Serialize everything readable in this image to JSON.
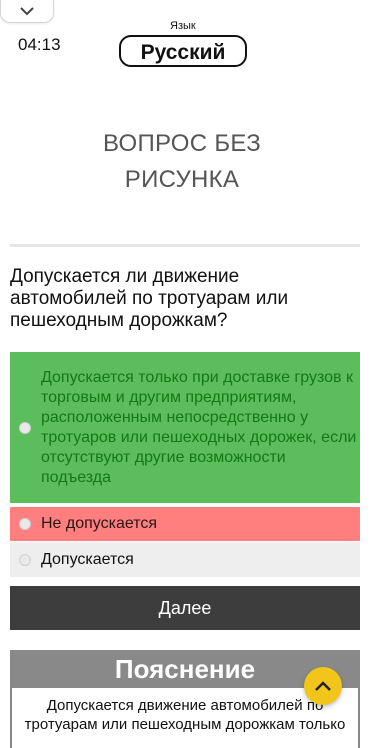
{
  "header": {
    "timer": "04:13",
    "language_caption": "Язык",
    "language_value": "Русский",
    "collapse_icon": "chevron-down-icon"
  },
  "image_placeholder": {
    "line1": "ВОПРОС БЕЗ",
    "line2": "РИСУНКА"
  },
  "question": {
    "text": "Допускается ли движение автомобилей по тротуарам или пешеходным дорожкам?"
  },
  "answers": [
    {
      "label": "Допускается только при доставке грузов к торговым и другим предприятиям, расположенным непосредственно у тротуаров или пешеходных дорожек, если отсутствуют другие возможности подъезда",
      "state": "correct",
      "color": "#5bbd5b"
    },
    {
      "label": "Не допускается",
      "state": "wrong-selected",
      "color": "#ff7f7f"
    },
    {
      "label": "Допускается",
      "state": "neutral",
      "color": "#eeeeee"
    }
  ],
  "next_button": {
    "label": "Далее"
  },
  "explanation": {
    "title": "Пояснение",
    "text": "Допускается движение автомобилей по тротуарам или пешеходным дорожкам только"
  },
  "scroll_top": {
    "icon": "chevron-up-icon",
    "color": "#f2c51b"
  }
}
